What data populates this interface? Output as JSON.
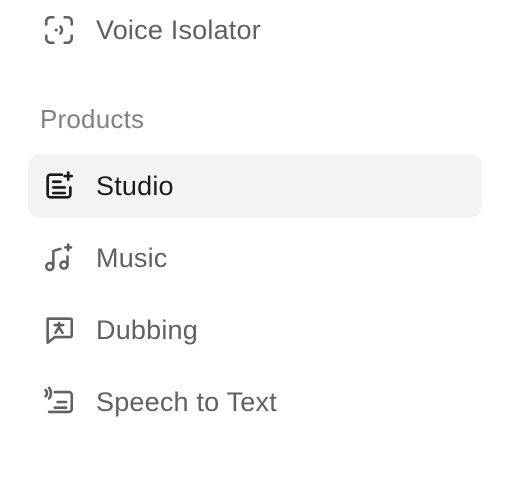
{
  "sidebar": {
    "top_items": [
      {
        "label": "Voice Isolator",
        "icon": "voice-isolator-icon"
      }
    ],
    "sections": [
      {
        "heading": "Products",
        "items": [
          {
            "label": "Studio",
            "icon": "studio-icon",
            "active": true
          },
          {
            "label": "Music",
            "icon": "music-icon",
            "active": false
          },
          {
            "label": "Dubbing",
            "icon": "dubbing-icon",
            "active": false
          },
          {
            "label": "Speech to Text",
            "icon": "speech-to-text-icon",
            "active": false
          }
        ]
      }
    ]
  },
  "colors": {
    "text_muted": "#5f5f66",
    "text_active": "#1b1b1f",
    "heading": "#80808a",
    "active_bg": "#f3f3f3"
  }
}
